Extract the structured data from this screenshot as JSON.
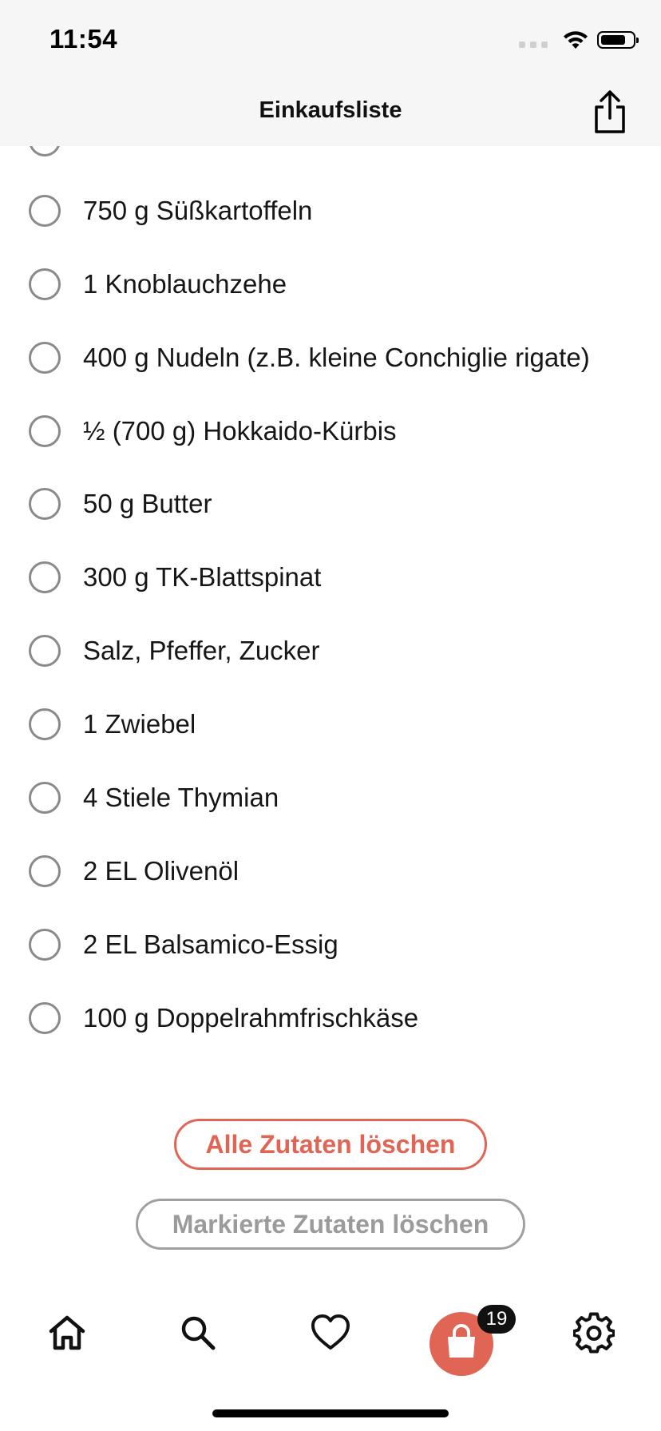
{
  "status": {
    "time": "11:54"
  },
  "header": {
    "title": "Einkaufsliste",
    "share_icon": "share-icon"
  },
  "items": [
    {
      "label": ""
    },
    {
      "label": "750 g Süßkartoffeln"
    },
    {
      "label": "1 Knoblauchzehe"
    },
    {
      "label": "400 g Nudeln  (z.B. kleine Conchiglie rigate)"
    },
    {
      "label": "½ (700 g) Hokkaido-Kürbis"
    },
    {
      "label": "50 g Butter"
    },
    {
      "label": "300 g TK-Blattspinat"
    },
    {
      "label": "Salz, Pfeffer, Zucker"
    },
    {
      "label": "1 Zwiebel"
    },
    {
      "label": "4 Stiele Thymian"
    },
    {
      "label": "2 EL Olivenöl"
    },
    {
      "label": "2 EL Balsamico-Essig"
    },
    {
      "label": "100 g Doppelrahmfrischkäse"
    }
  ],
  "actions": {
    "delete_all": "Alle Zutaten löschen",
    "delete_marked": "Markierte Zutaten löschen"
  },
  "tabbar": {
    "tabs": [
      "home-icon",
      "search-icon",
      "heart-icon",
      "shopping-bag-icon",
      "gear-icon"
    ],
    "cart_badge": "19"
  },
  "colors": {
    "accent": "#e06555",
    "disabled": "#9b9b9b",
    "header_bg": "#f6f6f6"
  }
}
